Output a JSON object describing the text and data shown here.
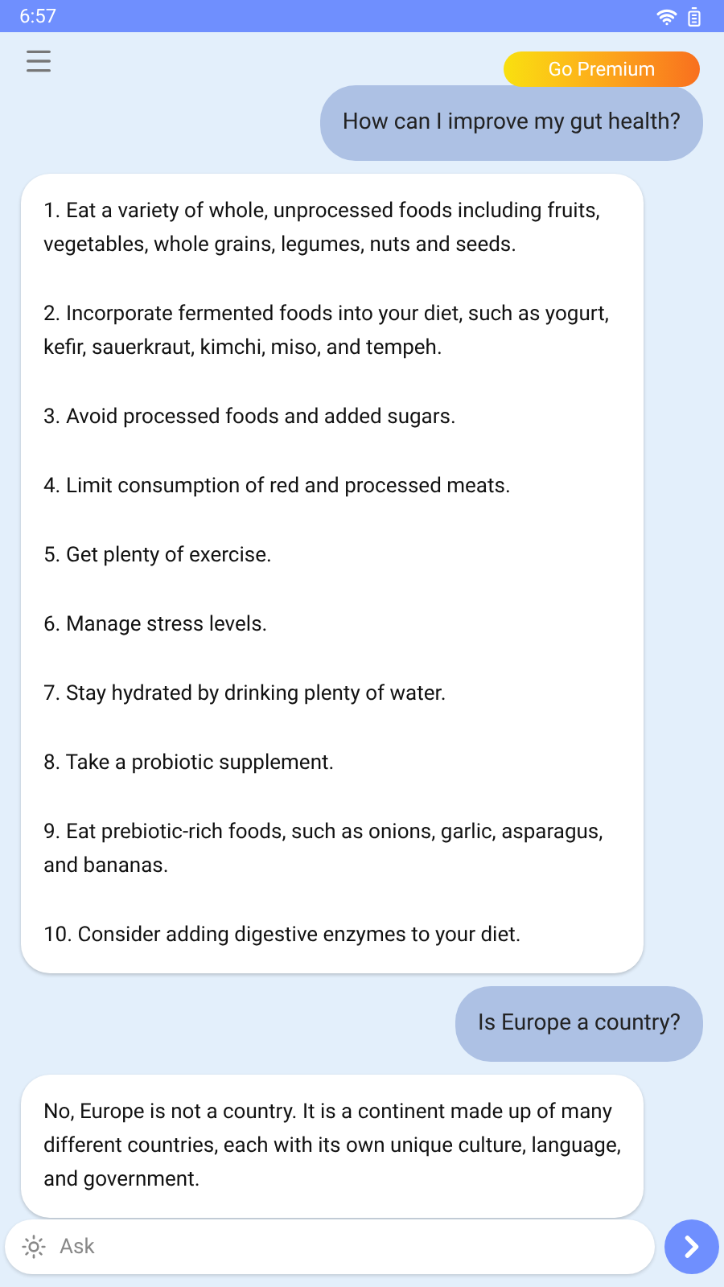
{
  "status_bar": {
    "time": "6:57"
  },
  "premium_button": {
    "label": "Go Premium"
  },
  "messages": [
    {
      "kind": "user",
      "paragraphs": [
        "How can I improve my gut health?"
      ]
    },
    {
      "kind": "assistant",
      "paragraphs": [
        "1. Eat a variety of whole, unprocessed foods including fruits, vegetables, whole grains, legumes, nuts and seeds.",
        "2. Incorporate fermented foods into your diet, such as yogurt, kefir, sauerkraut, kimchi, miso, and tempeh.",
        "3. Avoid processed foods and added sugars.",
        "4. Limit consumption of red and processed meats.",
        "5. Get plenty of exercise.",
        "6. Manage stress levels.",
        "7. Stay hydrated by drinking plenty of water.",
        "8. Take a probiotic supplement.",
        "9. Eat prebiotic-rich foods, such as onions, garlic, asparagus, and bananas.",
        "10. Consider adding digestive enzymes to your diet."
      ]
    },
    {
      "kind": "user",
      "paragraphs": [
        "Is Europe a country?"
      ]
    },
    {
      "kind": "assistant",
      "paragraphs": [
        "No, Europe is not a country. It is a continent made up of many different countries, each with its own unique culture, language, and government."
      ]
    }
  ],
  "input": {
    "placeholder": "Ask"
  }
}
